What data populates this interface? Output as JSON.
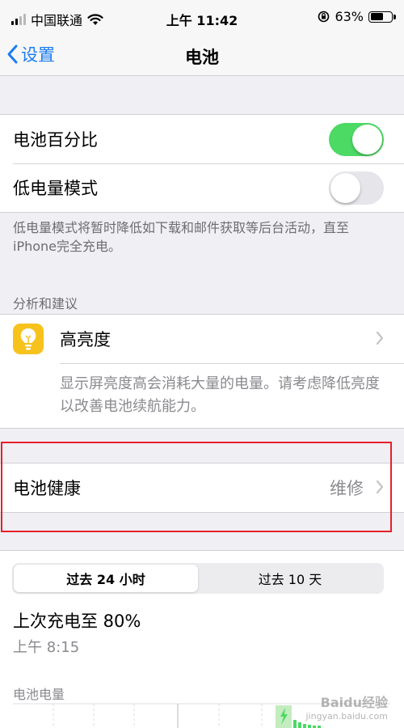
{
  "status_bar": {
    "carrier": "中国联通",
    "time": "上午 11:42",
    "battery_percent": "63%",
    "battery_level": 0.63
  },
  "nav": {
    "back_label": "设置",
    "title": "电池"
  },
  "settings": {
    "battery_percentage": {
      "label": "电池百分比",
      "on": true
    },
    "low_power_mode": {
      "label": "低电量模式",
      "on": false
    },
    "low_power_footnote": "低电量模式将暂时降低如下载和邮件获取等后台活动，直至iPhone完全充电。"
  },
  "insights": {
    "header": "分析和建议",
    "item": {
      "title": "高亮度",
      "description": "显示屏亮度高会消耗大量的电量。请考虑降低亮度以改善电池续航能力。"
    }
  },
  "battery_health": {
    "label": "电池健康",
    "status": "维修"
  },
  "usage": {
    "segments": [
      "过去 24 小时",
      "过去 10 天"
    ],
    "selected_segment": 0,
    "last_charge": "上次充电至 80%",
    "last_charge_time": "上午 8:15",
    "chart_label": "电池电量"
  },
  "watermark": {
    "main": "Baidu经验",
    "sub": "jingyan.baidu.com"
  },
  "colors": {
    "accent": "#1a7cf5",
    "toggle_on": "#4cd964",
    "highlight_box": "#e8202a",
    "bulb_icon": "#f7c21c"
  }
}
